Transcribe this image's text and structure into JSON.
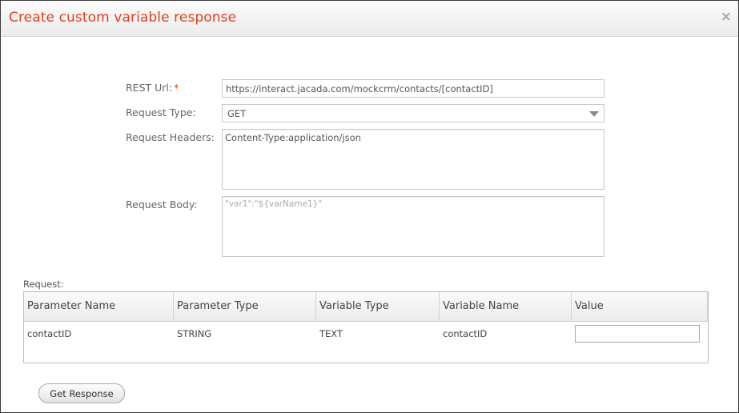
{
  "dialog": {
    "title": "Create custom variable response",
    "close_glyph": "×"
  },
  "form": {
    "rest_url": {
      "label": "REST Url:",
      "required_mark": "*",
      "value": "https://interact.jacada.com/mockcrm/contacts/[contactID]"
    },
    "request_type": {
      "label": "Request Type:",
      "value": "GET"
    },
    "request_headers": {
      "label": "Request Headers:",
      "value": "Content-Type:application/json"
    },
    "request_body": {
      "label": "Request Body:",
      "placeholder": "\"var1\":\"${varName1}\""
    }
  },
  "request_table": {
    "title": "Request:",
    "columns": [
      "Parameter Name",
      "Parameter Type",
      "Variable Type",
      "Variable Name",
      "Value"
    ],
    "rows": [
      {
        "parameter_name": "contactID",
        "parameter_type": "STRING",
        "variable_type": "TEXT",
        "variable_name": "contactID",
        "value": ""
      }
    ]
  },
  "actions": {
    "get_response_label": "Get Response"
  },
  "icons": {
    "close": "close-icon",
    "select_caret": "chevron-down-icon"
  },
  "colors": {
    "title": "#e2401c",
    "required": "#e2401c"
  }
}
